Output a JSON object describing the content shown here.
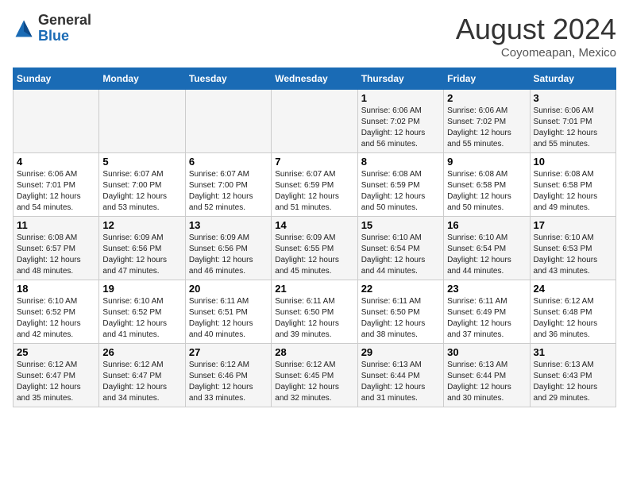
{
  "header": {
    "logo_general": "General",
    "logo_blue": "Blue",
    "month_year": "August 2024",
    "location": "Coyomeapan, Mexico"
  },
  "weekdays": [
    "Sunday",
    "Monday",
    "Tuesday",
    "Wednesday",
    "Thursday",
    "Friday",
    "Saturday"
  ],
  "weeks": [
    [
      {
        "day": "",
        "content": ""
      },
      {
        "day": "",
        "content": ""
      },
      {
        "day": "",
        "content": ""
      },
      {
        "day": "",
        "content": ""
      },
      {
        "day": "1",
        "content": "Sunrise: 6:06 AM\nSunset: 7:02 PM\nDaylight: 12 hours\nand 56 minutes."
      },
      {
        "day": "2",
        "content": "Sunrise: 6:06 AM\nSunset: 7:02 PM\nDaylight: 12 hours\nand 55 minutes."
      },
      {
        "day": "3",
        "content": "Sunrise: 6:06 AM\nSunset: 7:01 PM\nDaylight: 12 hours\nand 55 minutes."
      }
    ],
    [
      {
        "day": "4",
        "content": "Sunrise: 6:06 AM\nSunset: 7:01 PM\nDaylight: 12 hours\nand 54 minutes."
      },
      {
        "day": "5",
        "content": "Sunrise: 6:07 AM\nSunset: 7:00 PM\nDaylight: 12 hours\nand 53 minutes."
      },
      {
        "day": "6",
        "content": "Sunrise: 6:07 AM\nSunset: 7:00 PM\nDaylight: 12 hours\nand 52 minutes."
      },
      {
        "day": "7",
        "content": "Sunrise: 6:07 AM\nSunset: 6:59 PM\nDaylight: 12 hours\nand 51 minutes."
      },
      {
        "day": "8",
        "content": "Sunrise: 6:08 AM\nSunset: 6:59 PM\nDaylight: 12 hours\nand 50 minutes."
      },
      {
        "day": "9",
        "content": "Sunrise: 6:08 AM\nSunset: 6:58 PM\nDaylight: 12 hours\nand 50 minutes."
      },
      {
        "day": "10",
        "content": "Sunrise: 6:08 AM\nSunset: 6:58 PM\nDaylight: 12 hours\nand 49 minutes."
      }
    ],
    [
      {
        "day": "11",
        "content": "Sunrise: 6:08 AM\nSunset: 6:57 PM\nDaylight: 12 hours\nand 48 minutes."
      },
      {
        "day": "12",
        "content": "Sunrise: 6:09 AM\nSunset: 6:56 PM\nDaylight: 12 hours\nand 47 minutes."
      },
      {
        "day": "13",
        "content": "Sunrise: 6:09 AM\nSunset: 6:56 PM\nDaylight: 12 hours\nand 46 minutes."
      },
      {
        "day": "14",
        "content": "Sunrise: 6:09 AM\nSunset: 6:55 PM\nDaylight: 12 hours\nand 45 minutes."
      },
      {
        "day": "15",
        "content": "Sunrise: 6:10 AM\nSunset: 6:54 PM\nDaylight: 12 hours\nand 44 minutes."
      },
      {
        "day": "16",
        "content": "Sunrise: 6:10 AM\nSunset: 6:54 PM\nDaylight: 12 hours\nand 44 minutes."
      },
      {
        "day": "17",
        "content": "Sunrise: 6:10 AM\nSunset: 6:53 PM\nDaylight: 12 hours\nand 43 minutes."
      }
    ],
    [
      {
        "day": "18",
        "content": "Sunrise: 6:10 AM\nSunset: 6:52 PM\nDaylight: 12 hours\nand 42 minutes."
      },
      {
        "day": "19",
        "content": "Sunrise: 6:10 AM\nSunset: 6:52 PM\nDaylight: 12 hours\nand 41 minutes."
      },
      {
        "day": "20",
        "content": "Sunrise: 6:11 AM\nSunset: 6:51 PM\nDaylight: 12 hours\nand 40 minutes."
      },
      {
        "day": "21",
        "content": "Sunrise: 6:11 AM\nSunset: 6:50 PM\nDaylight: 12 hours\nand 39 minutes."
      },
      {
        "day": "22",
        "content": "Sunrise: 6:11 AM\nSunset: 6:50 PM\nDaylight: 12 hours\nand 38 minutes."
      },
      {
        "day": "23",
        "content": "Sunrise: 6:11 AM\nSunset: 6:49 PM\nDaylight: 12 hours\nand 37 minutes."
      },
      {
        "day": "24",
        "content": "Sunrise: 6:12 AM\nSunset: 6:48 PM\nDaylight: 12 hours\nand 36 minutes."
      }
    ],
    [
      {
        "day": "25",
        "content": "Sunrise: 6:12 AM\nSunset: 6:47 PM\nDaylight: 12 hours\nand 35 minutes."
      },
      {
        "day": "26",
        "content": "Sunrise: 6:12 AM\nSunset: 6:47 PM\nDaylight: 12 hours\nand 34 minutes."
      },
      {
        "day": "27",
        "content": "Sunrise: 6:12 AM\nSunset: 6:46 PM\nDaylight: 12 hours\nand 33 minutes."
      },
      {
        "day": "28",
        "content": "Sunrise: 6:12 AM\nSunset: 6:45 PM\nDaylight: 12 hours\nand 32 minutes."
      },
      {
        "day": "29",
        "content": "Sunrise: 6:13 AM\nSunset: 6:44 PM\nDaylight: 12 hours\nand 31 minutes."
      },
      {
        "day": "30",
        "content": "Sunrise: 6:13 AM\nSunset: 6:44 PM\nDaylight: 12 hours\nand 30 minutes."
      },
      {
        "day": "31",
        "content": "Sunrise: 6:13 AM\nSunset: 6:43 PM\nDaylight: 12 hours\nand 29 minutes."
      }
    ]
  ]
}
